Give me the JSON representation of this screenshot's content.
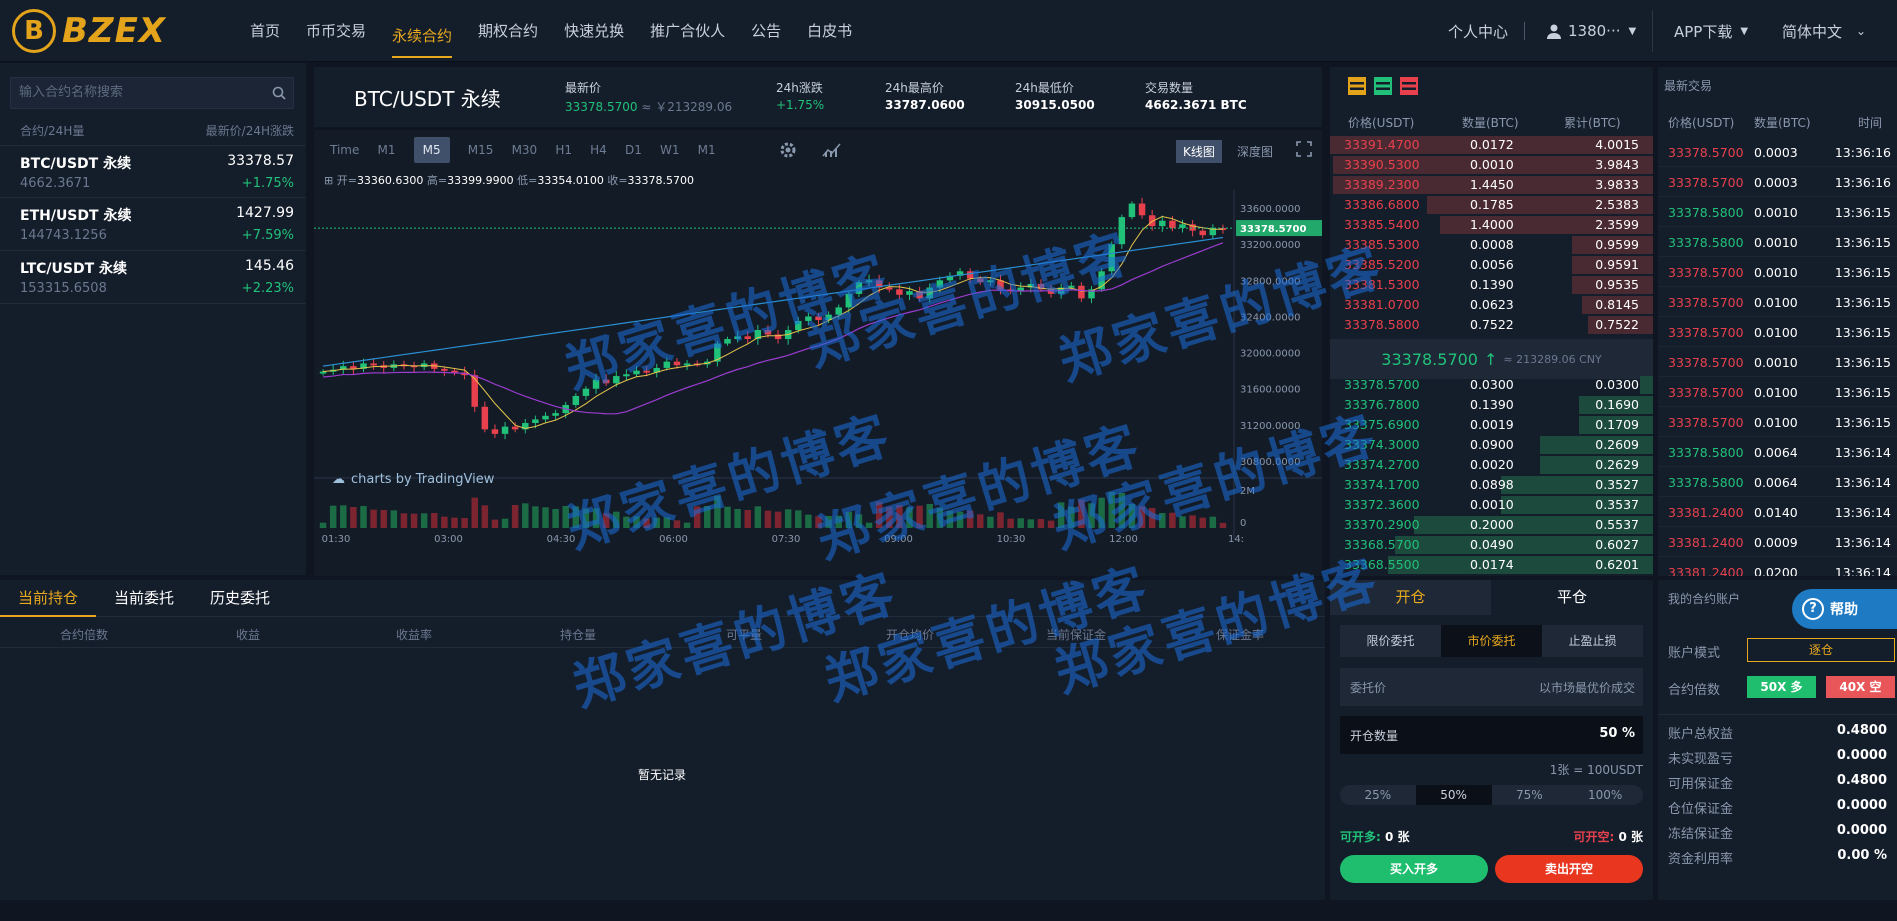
{
  "brand": {
    "logo_letter": "B",
    "name": "BZEX"
  },
  "nav": [
    "首页",
    "币币交易",
    "永续合约",
    "期权合约",
    "快速兑换",
    "推广合伙人",
    "公告",
    "白皮书"
  ],
  "header_right": {
    "user_center": "个人中心",
    "user_name": "1380···",
    "app_download": "APP下载",
    "language": "简体中文"
  },
  "left": {
    "search_placeholder": "输入合约名称搜索",
    "col_left": "合约/24H量",
    "col_right": "最新价/24H涨跌",
    "rows": [
      {
        "name": "BTC/USDT 永续",
        "volume": "4662.3671",
        "price": "33378.57",
        "change": "+1.75%"
      },
      {
        "name": "ETH/USDT 永续",
        "volume": "144743.1256",
        "price": "1427.99",
        "change": "+7.59%"
      },
      {
        "name": "LTC/USDT 永续",
        "volume": "153315.6508",
        "price": "145.46",
        "change": "+2.23%"
      }
    ]
  },
  "ticker": {
    "symbol": "BTC/USDT 永续",
    "last_label": "最新价",
    "last_price": "33378.5700",
    "last_cny": "≈ ￥213289.06",
    "change_label": "24h涨跌",
    "change": "+1.75%",
    "high_label": "24h最高价",
    "high": "33787.0600",
    "low_label": "24h最低价",
    "low": "30915.0500",
    "vol_label": "交易数量",
    "vol": "4662.3671 BTC"
  },
  "chart_toolbar": {
    "intervals": [
      "Time",
      "M1",
      "M5",
      "M15",
      "M30",
      "H1",
      "H4",
      "D1",
      "W1",
      "M1"
    ],
    "selected": "M5",
    "kline": "K线图",
    "depth": "深度图"
  },
  "ohlc": {
    "open_label": "开=",
    "open": "33360.6300",
    "high_label": "高=",
    "high": "33399.9900",
    "low_label": "低=",
    "low": "33354.0100",
    "close_label": "收=",
    "close": "33378.5700"
  },
  "tv_credit": "charts by TradingView",
  "chart_data": {
    "type": "candlestick",
    "y_ticks": [
      "33600.0000",
      "33200.0000",
      "32800.0000",
      "32400.0000",
      "32000.0000",
      "31600.0000",
      "31200.0000",
      "30800.0000"
    ],
    "y_range": [
      30700,
      33800
    ],
    "x_ticks": [
      "01:30",
      "03:00",
      "04:30",
      "06:00",
      "07:30",
      "09:00",
      "10:30",
      "12:00",
      "14:"
    ],
    "current_price_tag": "33378.5700",
    "volume_ticks": [
      "2M",
      "0"
    ],
    "close_series": [
      31790,
      31810,
      31850,
      31820,
      31880,
      31860,
      31830,
      31870,
      31860,
      31840,
      31880,
      31820,
      31800,
      31780,
      31750,
      31400,
      31150,
      31100,
      31180,
      31150,
      31220,
      31260,
      31300,
      31330,
      31420,
      31520,
      31600,
      31700,
      31660,
      31740,
      31760,
      31800,
      31780,
      31830,
      31900,
      31860,
      31880,
      31870,
      31900,
      32100,
      32150,
      32180,
      32150,
      32250,
      32200,
      32150,
      32250,
      32350,
      32400,
      32360,
      32420,
      32500,
      32650,
      32780,
      32800,
      32720,
      32700,
      32640,
      32680,
      32600,
      32720,
      32800,
      32850,
      32900,
      32820,
      32780,
      32800,
      32700,
      32680,
      32720,
      32760,
      32700,
      32650,
      32720,
      32740,
      32600,
      32700,
      32900,
      33200,
      33500,
      33650,
      33520,
      33400,
      33460,
      33380,
      33420,
      33350,
      33300,
      33380,
      33378
    ]
  },
  "orderbook": {
    "headers": [
      "价格(USDT)",
      "数量(BTC)",
      "累计(BTC)"
    ],
    "asks": [
      [
        "33391.4700",
        "0.0172",
        "4.0015",
        1.0
      ],
      [
        "33390.5300",
        "0.0010",
        "3.9843",
        0.99
      ],
      [
        "33389.2300",
        "1.4450",
        "3.9833",
        0.99
      ],
      [
        "33386.6800",
        "0.1785",
        "2.5383",
        0.7
      ],
      [
        "33385.5400",
        "1.4000",
        "2.3599",
        0.66
      ],
      [
        "33385.5300",
        "0.0008",
        "0.9599",
        0.25
      ],
      [
        "33385.5200",
        "0.0056",
        "0.9591",
        0.25
      ],
      [
        "33381.5300",
        "0.1390",
        "0.9535",
        0.25
      ],
      [
        "33381.0700",
        "0.0623",
        "0.8145",
        0.22
      ],
      [
        "33378.5800",
        "0.7522",
        "0.7522",
        0.2
      ]
    ],
    "mid_price": "33378.5700",
    "mid_arrow": "↑",
    "mid_cny": "≈ 213289.06 CNY",
    "bids": [
      [
        "33378.5700",
        "0.0300",
        "0.0300",
        0.04
      ],
      [
        "33376.7800",
        "0.1390",
        "0.1690",
        0.23
      ],
      [
        "33375.6900",
        "0.0019",
        "0.1709",
        0.23
      ],
      [
        "33374.3000",
        "0.0900",
        "0.2609",
        0.35
      ],
      [
        "33374.2700",
        "0.0020",
        "0.2629",
        0.35
      ],
      [
        "33374.1700",
        "0.0898",
        "0.3527",
        0.47
      ],
      [
        "33372.3600",
        "0.0010",
        "0.3537",
        0.47
      ],
      [
        "33370.2900",
        "0.2000",
        "0.5537",
        0.74
      ],
      [
        "33368.5700",
        "0.0490",
        "0.6027",
        0.8
      ],
      [
        "33368.5500",
        "0.0174",
        "0.6201",
        0.82
      ]
    ]
  },
  "trades": {
    "title": "最新交易",
    "headers": [
      "价格(USDT)",
      "数量(BTC)",
      "时间"
    ],
    "rows": [
      [
        "33378.5700",
        "0.0003",
        "13:36:16",
        "red"
      ],
      [
        "33378.5700",
        "0.0003",
        "13:36:16",
        "red"
      ],
      [
        "33378.5800",
        "0.0010",
        "13:36:15",
        "green"
      ],
      [
        "33378.5800",
        "0.0010",
        "13:36:15",
        "green"
      ],
      [
        "33378.5700",
        "0.0010",
        "13:36:15",
        "red"
      ],
      [
        "33378.5700",
        "0.0100",
        "13:36:15",
        "red"
      ],
      [
        "33378.5700",
        "0.0100",
        "13:36:15",
        "red"
      ],
      [
        "33378.5700",
        "0.0010",
        "13:36:15",
        "red"
      ],
      [
        "33378.5700",
        "0.0100",
        "13:36:15",
        "red"
      ],
      [
        "33378.5700",
        "0.0100",
        "13:36:15",
        "red"
      ],
      [
        "33378.5800",
        "0.0064",
        "13:36:14",
        "green"
      ],
      [
        "33378.5800",
        "0.0064",
        "13:36:14",
        "green"
      ],
      [
        "33381.2400",
        "0.0140",
        "13:36:14",
        "red"
      ],
      [
        "33381.2400",
        "0.0009",
        "13:36:14",
        "red"
      ],
      [
        "33381.2400",
        "0.0200",
        "13:36:14",
        "red"
      ]
    ]
  },
  "positions": {
    "tabs": [
      "当前持仓",
      "当前委托",
      "历史委托"
    ],
    "columns": [
      "合约倍数",
      "收益",
      "收益率",
      "持仓量",
      "可平量",
      "开仓均价",
      "当前保证金",
      "保证金率"
    ],
    "empty": "暂无记录"
  },
  "trade": {
    "tabs": [
      "开仓",
      "平仓"
    ],
    "modes": [
      "限价委托",
      "市价委托",
      "止盈止损"
    ],
    "price_label": "委托价",
    "price_hint": "以市场最优价成交",
    "qty_label": "开仓数量",
    "qty_value": "50 %",
    "unit_note": "1张 = 100USDT",
    "percents": [
      "25%",
      "50%",
      "75%",
      "100%"
    ],
    "can_long_label": "可开多:",
    "can_long": "0 张",
    "can_short_label": "可开空:",
    "can_short": "0 张",
    "buy": "买入开多",
    "sell": "卖出开空"
  },
  "account": {
    "title": "我的合约账户",
    "help": "帮助",
    "mode_label": "账户模式",
    "mode_value": "逐仓",
    "lev_label": "合约倍数",
    "lev_long": "50X 多",
    "lev_short": "40X 空",
    "rows": [
      [
        "账户总权益",
        "0.4800"
      ],
      [
        "未实现盈亏",
        "0.0000"
      ],
      [
        "可用保证金",
        "0.4800"
      ],
      [
        "仓位保证金",
        "0.0000"
      ],
      [
        "冻结保证金",
        "0.0000"
      ],
      [
        "资金利用率",
        "0.00 %"
      ]
    ]
  },
  "watermark": "郑家喜的博客",
  "colors": {
    "accent": "#e9a91e",
    "up": "#21c17a",
    "down": "#e8414d",
    "bg": "#141d2a"
  }
}
